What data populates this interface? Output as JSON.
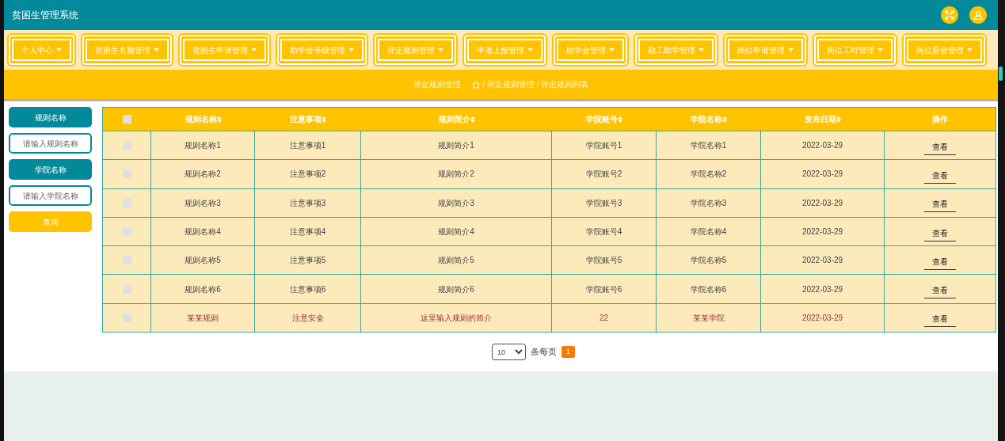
{
  "header": {
    "title": "贫困生管理系统"
  },
  "nav": [
    {
      "label": "个人中心"
    },
    {
      "label": "贫困生名额管理"
    },
    {
      "label": "贫困生申请管理"
    },
    {
      "label": "助学金等级管理"
    },
    {
      "label": "评定规则管理"
    },
    {
      "label": "申请上报管理"
    },
    {
      "label": "助学金管理"
    },
    {
      "label": "勤工助学管理"
    },
    {
      "label": "岗位申请管理"
    },
    {
      "label": "岗位工时管理"
    },
    {
      "label": "岗位薪金管理"
    }
  ],
  "breadcrumb": {
    "title": "评定规则管理",
    "path": "/ 评定规则管理 / 评定规则列表"
  },
  "search": [
    {
      "kind": "label",
      "text": "规则名称"
    },
    {
      "kind": "field",
      "placeholder": "请输入规则名称"
    },
    {
      "kind": "label",
      "text": "学院名称"
    },
    {
      "kind": "field",
      "placeholder": "请输入学院名称"
    },
    {
      "kind": "button",
      "text": "查询"
    }
  ],
  "table": {
    "select_all_checked": false,
    "columns": [
      {
        "label": "规则名称",
        "sortable": true
      },
      {
        "label": "注意事项",
        "sortable": true
      },
      {
        "label": "规则简介",
        "sortable": true
      },
      {
        "label": "学院账号",
        "sortable": true
      },
      {
        "label": "学院名称",
        "sortable": true
      },
      {
        "label": "发布日期",
        "sortable": true
      },
      {
        "label": "操作",
        "sortable": false
      }
    ],
    "rows": [
      {
        "checked": false,
        "highlighted": false,
        "cells": [
          "规则名称1",
          "注意事项1",
          "规则简介1",
          "学院账号1",
          "学院名称1",
          "2022-03-29"
        ],
        "action": "查看"
      },
      {
        "checked": false,
        "highlighted": false,
        "cells": [
          "规则名称2",
          "注意事项2",
          "规则简介2",
          "学院账号2",
          "学院名称2",
          "2022-03-29"
        ],
        "action": "查看"
      },
      {
        "checked": false,
        "highlighted": false,
        "cells": [
          "规则名称3",
          "注意事项3",
          "规则简介3",
          "学院账号3",
          "学院名称3",
          "2022-03-29"
        ],
        "action": "查看"
      },
      {
        "checked": false,
        "highlighted": false,
        "cells": [
          "规则名称4",
          "注意事项4",
          "规则简介4",
          "学院账号4",
          "学院名称4",
          "2022-03-29"
        ],
        "action": "查看"
      },
      {
        "checked": false,
        "highlighted": false,
        "cells": [
          "规则名称5",
          "注意事项5",
          "规则简介5",
          "学院账号5",
          "学院名称5",
          "2022-03-29"
        ],
        "action": "查看"
      },
      {
        "checked": false,
        "highlighted": false,
        "cells": [
          "规则名称6",
          "注意事项6",
          "规则简介6",
          "学院账号6",
          "学院名称6",
          "2022-03-29"
        ],
        "action": "查看"
      },
      {
        "checked": false,
        "highlighted": true,
        "cells": [
          "某某规则",
          "注意安全",
          "这里输入规则的简介",
          "22",
          "某某学院",
          "2022-03-29"
        ],
        "action": "查看"
      }
    ]
  },
  "pagination": {
    "page_size": "10",
    "per_page_label": "条每页",
    "pages": [
      {
        "label": "1",
        "selected": true
      }
    ]
  }
}
